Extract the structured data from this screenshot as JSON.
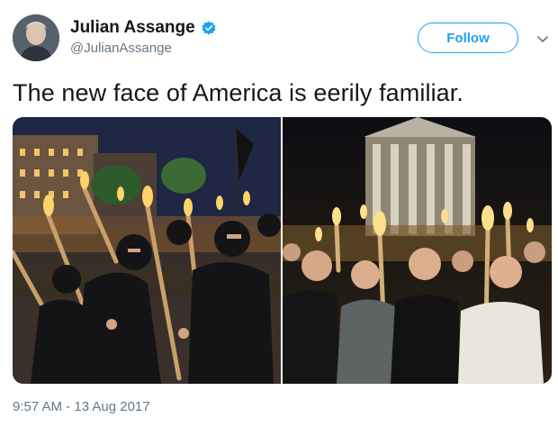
{
  "tweet": {
    "author": {
      "display_name": "Julian Assange",
      "handle": "@JulianAssange",
      "verified": true,
      "avatar_icon": "user-avatar"
    },
    "follow_label": "Follow",
    "more_menu_icon": "chevron-down-icon",
    "text": "The new face of America is eerily familiar.",
    "media": [
      {
        "description_icon": "photo-torch-march-masked"
      },
      {
        "description_icon": "photo-torch-march-rotunda"
      }
    ],
    "timestamp": "9:57 AM - 13 Aug 2017"
  },
  "colors": {
    "brand_blue": "#1da1f2",
    "text_primary": "#14171a",
    "text_secondary": "#657786"
  }
}
